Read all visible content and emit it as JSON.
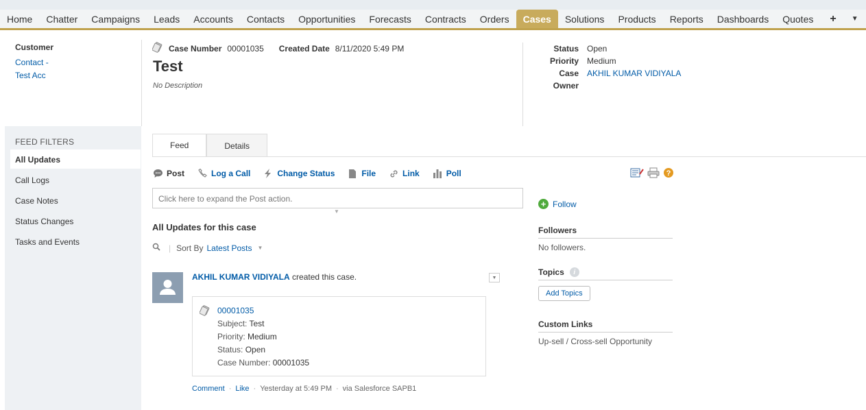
{
  "nav": {
    "items": [
      "Home",
      "Chatter",
      "Campaigns",
      "Leads",
      "Accounts",
      "Contacts",
      "Opportunities",
      "Forecasts",
      "Contracts",
      "Orders",
      "Cases",
      "Solutions",
      "Products",
      "Reports",
      "Dashboards",
      "Quotes"
    ],
    "active": "Cases",
    "plus": "+",
    "caret": "▼"
  },
  "header": {
    "customer_label": "Customer",
    "customer_line1": "Contact -",
    "customer_line2": "Test Acc",
    "case_number_label": "Case Number",
    "case_number": "00001035",
    "created_label": "Created Date",
    "created_value": "8/11/2020 5:49 PM",
    "title": "Test",
    "description": "No Description",
    "status_label": "Status",
    "status": "Open",
    "priority_label": "Priority",
    "priority": "Medium",
    "owner_label": "Case Owner",
    "owner": "AKHIL KUMAR VIDIYALA"
  },
  "filters": {
    "title": "FEED FILTERS",
    "items": [
      "All Updates",
      "Call Logs",
      "Case Notes",
      "Status Changes",
      "Tasks and Events"
    ]
  },
  "tabs": [
    "Feed",
    "Details"
  ],
  "publisher": {
    "actions": [
      "Post",
      "Log a Call",
      "Change Status",
      "File",
      "Link",
      "Poll"
    ],
    "placeholder": "Click here to expand the Post action."
  },
  "feed": {
    "title": "All Updates for this case",
    "sort_label": "Sort By",
    "sort_value": "Latest Posts",
    "item": {
      "author": "AKHIL KUMAR VIDIYALA",
      "action": " created this case.",
      "card_number": "00001035",
      "subject_label": "Subject:",
      "subject": "Test",
      "priority_label": "Priority:",
      "priority": "Medium",
      "status_label": "Status:",
      "status": "Open",
      "casenum_label": "Case Number:",
      "casenum": "00001035",
      "comment": "Comment",
      "like": "Like",
      "time": "Yesterday at 5:49 PM",
      "via": "via Salesforce SAPB1"
    }
  },
  "sidebar": {
    "follow": "Follow",
    "followers_title": "Followers",
    "followers_body": "No followers.",
    "topics_title": "Topics",
    "add_topics": "Add Topics",
    "links_title": "Custom Links",
    "link1": "Up-sell / Cross-sell Opportunity"
  },
  "colors": {
    "active_tab": "#c8ab5c",
    "link": "#015ba7"
  }
}
